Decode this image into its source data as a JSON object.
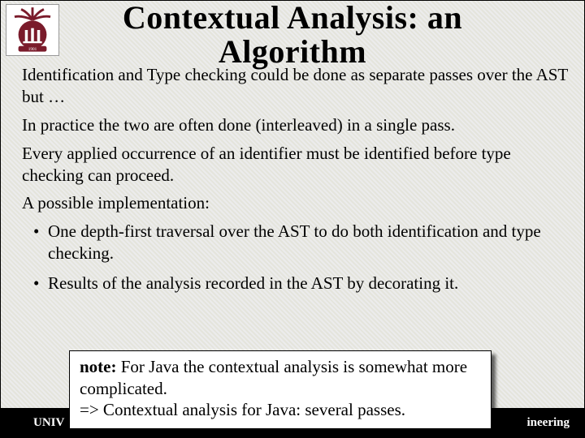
{
  "title_line1": "Contextual Analysis: an",
  "title_line2": "Algorithm",
  "paragraphs": {
    "p1": "Identification and Type checking could be done as separate passes over the AST but …",
    "p2": "In practice the two are often done (interleaved) in a single pass.",
    "p3": "Every applied occurrence of an identifier must be identified before type checking can proceed.",
    "p4": "A possible implementation:"
  },
  "bullets": {
    "b1": "One depth-first traversal over the AST to do both identification and type checking.",
    "b2": "Results of the analysis recorded in the AST by decorating it."
  },
  "note": {
    "label": "note:",
    "line1_rest": " For Java the contextual analysis is somewhat more complicated.",
    "line2": "=> Contextual analysis for Java: several passes."
  },
  "footer": {
    "left": "UNIV",
    "right": "ineering"
  },
  "colors": {
    "logo_primary": "#7a1b2b"
  }
}
